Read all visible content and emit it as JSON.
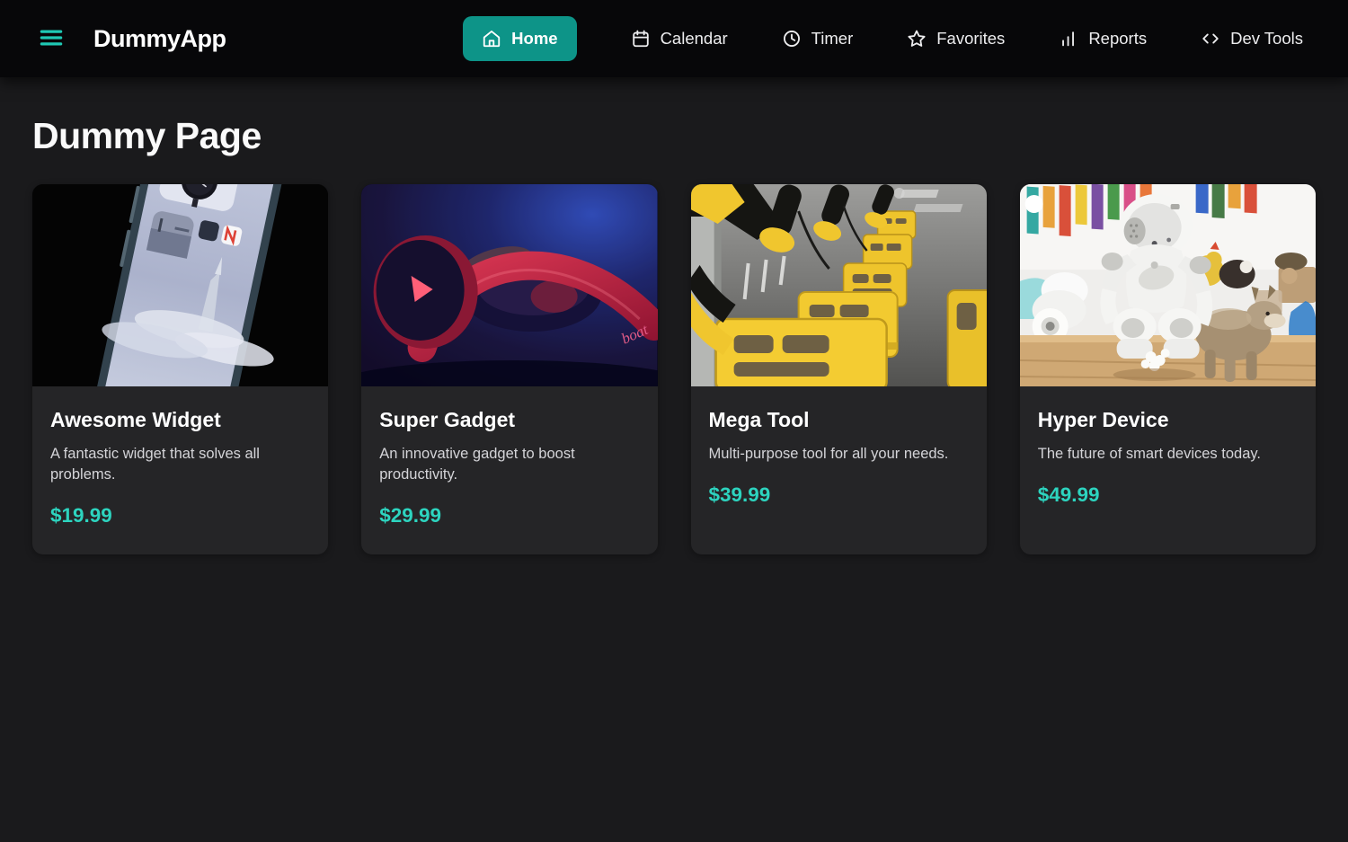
{
  "app": {
    "name": "DummyApp"
  },
  "nav": {
    "items": [
      {
        "label": "Home",
        "icon": "home-icon",
        "active": true
      },
      {
        "label": "Calendar",
        "icon": "calendar-icon",
        "active": false
      },
      {
        "label": "Timer",
        "icon": "clock-icon",
        "active": false
      },
      {
        "label": "Favorites",
        "icon": "star-icon",
        "active": false
      },
      {
        "label": "Reports",
        "icon": "bar-chart-icon",
        "active": false
      },
      {
        "label": "Dev Tools",
        "icon": "code-icon",
        "active": false
      }
    ]
  },
  "page": {
    "title": "Dummy Page"
  },
  "products": [
    {
      "name": "Awesome Widget",
      "description": "A fantastic widget that solves all problems.",
      "price": "$19.99",
      "image": "smartphone-home-screen-with-widgets"
    },
    {
      "name": "Super Gadget",
      "description": "An innovative gadget to boost productivity.",
      "price": "$29.99",
      "image": "red-wireless-headphones-on-blue-background",
      "image_text": "boat"
    },
    {
      "name": "Mega Tool",
      "description": "Multi-purpose tool for all your needs.",
      "price": "$39.99",
      "image": "row-of-yellow-share-bikes-with-baskets"
    },
    {
      "name": "Hyper Device",
      "description": "The future of smart devices today.",
      "price": "$49.99",
      "image": "white-humanoid-robot-with-plush-toys"
    }
  ],
  "colors": {
    "accent": "#2dd4bf",
    "active_nav_background": "#0d9488",
    "header_background": "#070709",
    "page_background": "#1a1a1c",
    "card_background": "#252527"
  }
}
